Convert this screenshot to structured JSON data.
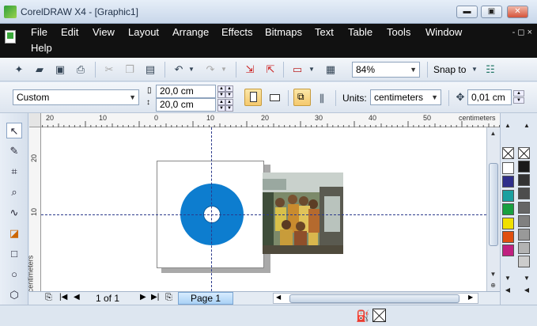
{
  "window": {
    "title": "CorelDRAW X4 - [Graphic1]",
    "min": "▬",
    "max": "▣",
    "close": "✕"
  },
  "menu": {
    "items": [
      "File",
      "Edit",
      "View",
      "Layout",
      "Arrange",
      "Effects",
      "Bitmaps",
      "Text",
      "Table",
      "Tools",
      "Window",
      "Help"
    ],
    "controls": "-  ◻  ×"
  },
  "toolbar1": {
    "zoom": "84%",
    "snap": "Snap to"
  },
  "toolbar2": {
    "paper": "Custom",
    "width": "20,0 cm",
    "height": "20,0 cm",
    "units_label": "Units:",
    "units": "centimeters",
    "nudge": "0,01 cm"
  },
  "ruler": {
    "unit": "centimeters",
    "top_labels": [
      "20",
      "10",
      "0",
      "10",
      "20",
      "30",
      "40",
      "50"
    ],
    "left_labels": [
      "20",
      "10"
    ],
    "left_unit": "centimeters"
  },
  "pagebar": {
    "page_count": "1 of 1",
    "tab": "Page 1"
  },
  "palette": {
    "col1": [
      "#ffffff",
      "#2e2e8a",
      "#1aa0a0",
      "#18a040",
      "#f0e000",
      "#e05010",
      "#c02080"
    ],
    "col2": [
      "#1a1a1a",
      "#333333",
      "#4d4d4d",
      "#666666",
      "#808080",
      "#999999",
      "#b3b3b3",
      "#cccccc"
    ]
  }
}
